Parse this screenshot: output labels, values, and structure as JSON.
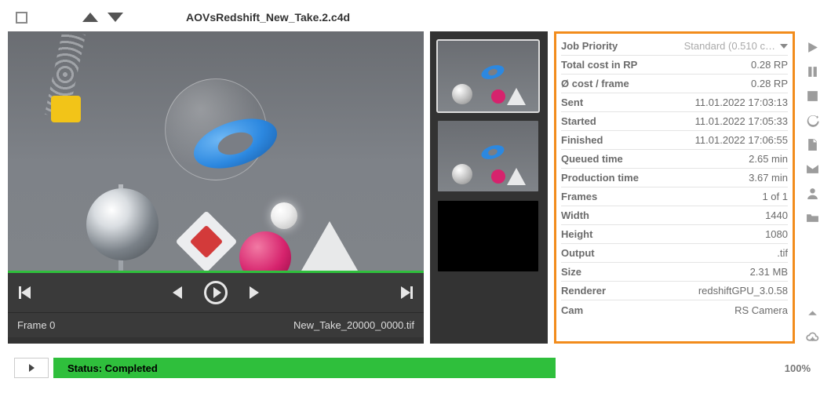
{
  "header": {
    "title": "AOVsRedshift_New_Take.2.c4d"
  },
  "viewer": {
    "frame_label": "Frame 0",
    "filename": "New_Take_20000_0000.tif"
  },
  "details": {
    "priority_label": "Job Priority",
    "priority_value": "Standard (0.510 c…",
    "rows": [
      {
        "label": "Total cost in RP",
        "value": "0.28 RP"
      },
      {
        "label": "Ø cost / frame",
        "value": "0.28 RP"
      },
      {
        "label": "Sent",
        "value": "11.01.2022 17:03:13"
      },
      {
        "label": "Started",
        "value": "11.01.2022 17:05:33"
      },
      {
        "label": "Finished",
        "value": "11.01.2022 17:06:55"
      },
      {
        "label": "Queued time",
        "value": "2.65 min"
      },
      {
        "label": "Production time",
        "value": "3.67 min"
      },
      {
        "label": "Frames",
        "value": "1 of 1"
      },
      {
        "label": "Width",
        "value": "1440"
      },
      {
        "label": "Height",
        "value": "1080"
      },
      {
        "label": "Output",
        "value": ".tif"
      },
      {
        "label": "Size",
        "value": "2.31 MB"
      },
      {
        "label": "Renderer",
        "value": "redshiftGPU_3.0.58"
      },
      {
        "label": "Cam",
        "value": "RS Camera"
      }
    ]
  },
  "status": {
    "text": "Status: Completed",
    "percent": "100%"
  }
}
